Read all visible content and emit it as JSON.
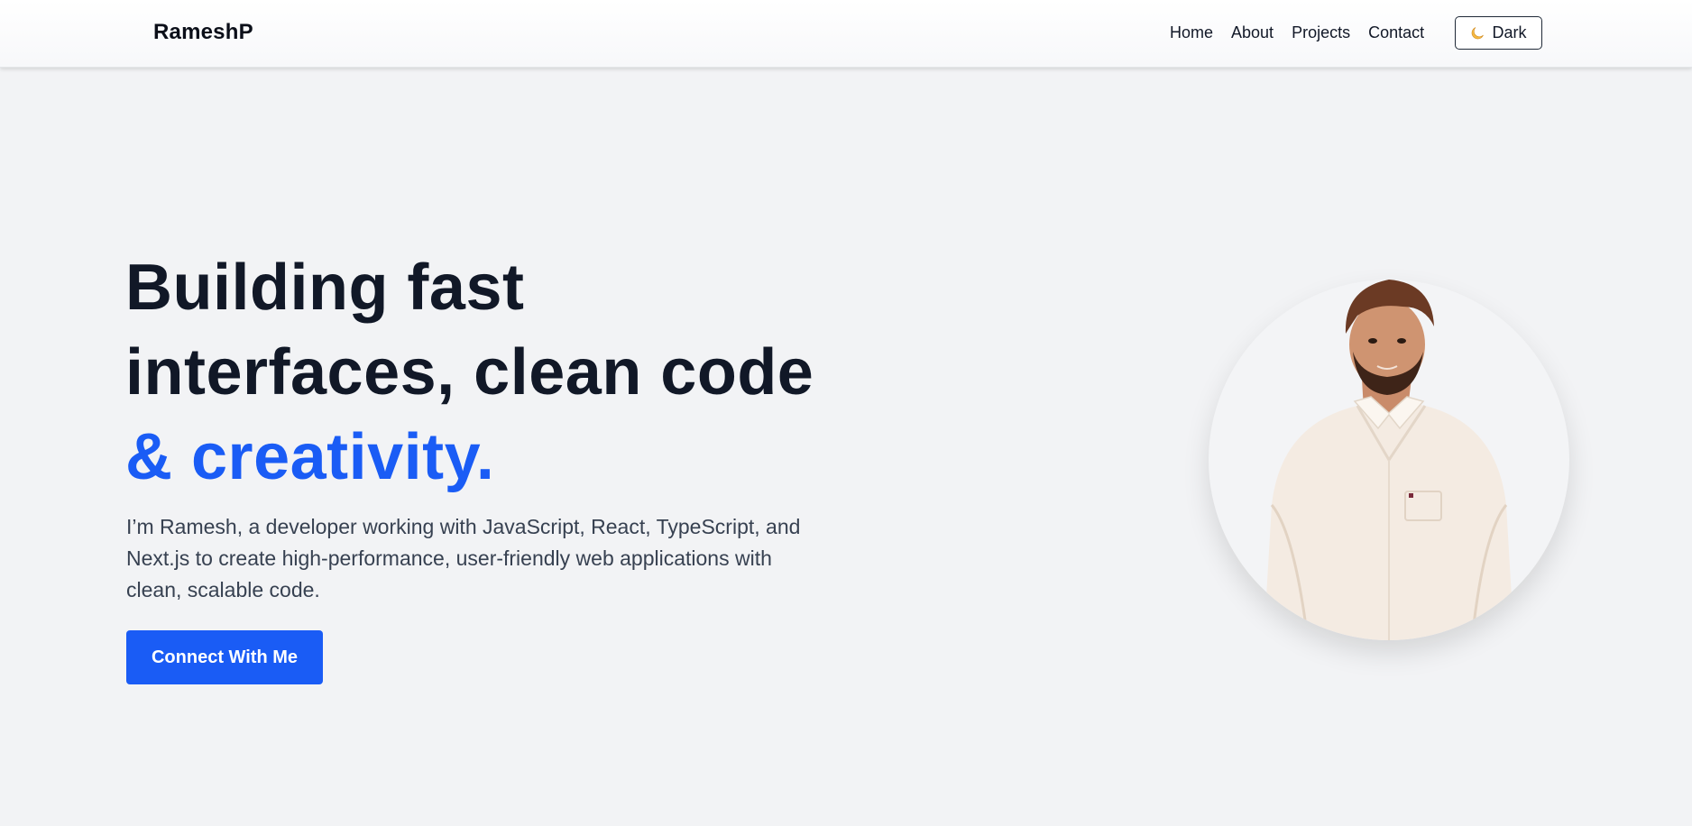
{
  "brand": "RameshP",
  "nav": {
    "links": [
      "Home",
      "About",
      "Projects",
      "Contact"
    ],
    "theme_toggle": {
      "icon": "moon-icon",
      "label": "Dark"
    }
  },
  "hero": {
    "title_line1": "Building fast",
    "title_line2": "interfaces, clean code",
    "title_accent": "& creativity.",
    "description": "I’m Ramesh, a developer working with JavaScript, React, TypeScript, and Next.js to create high-performance, user-friendly web applications with clean, scalable code.",
    "cta_label": "Connect With Me",
    "accent_color": "#1a5cf5"
  }
}
